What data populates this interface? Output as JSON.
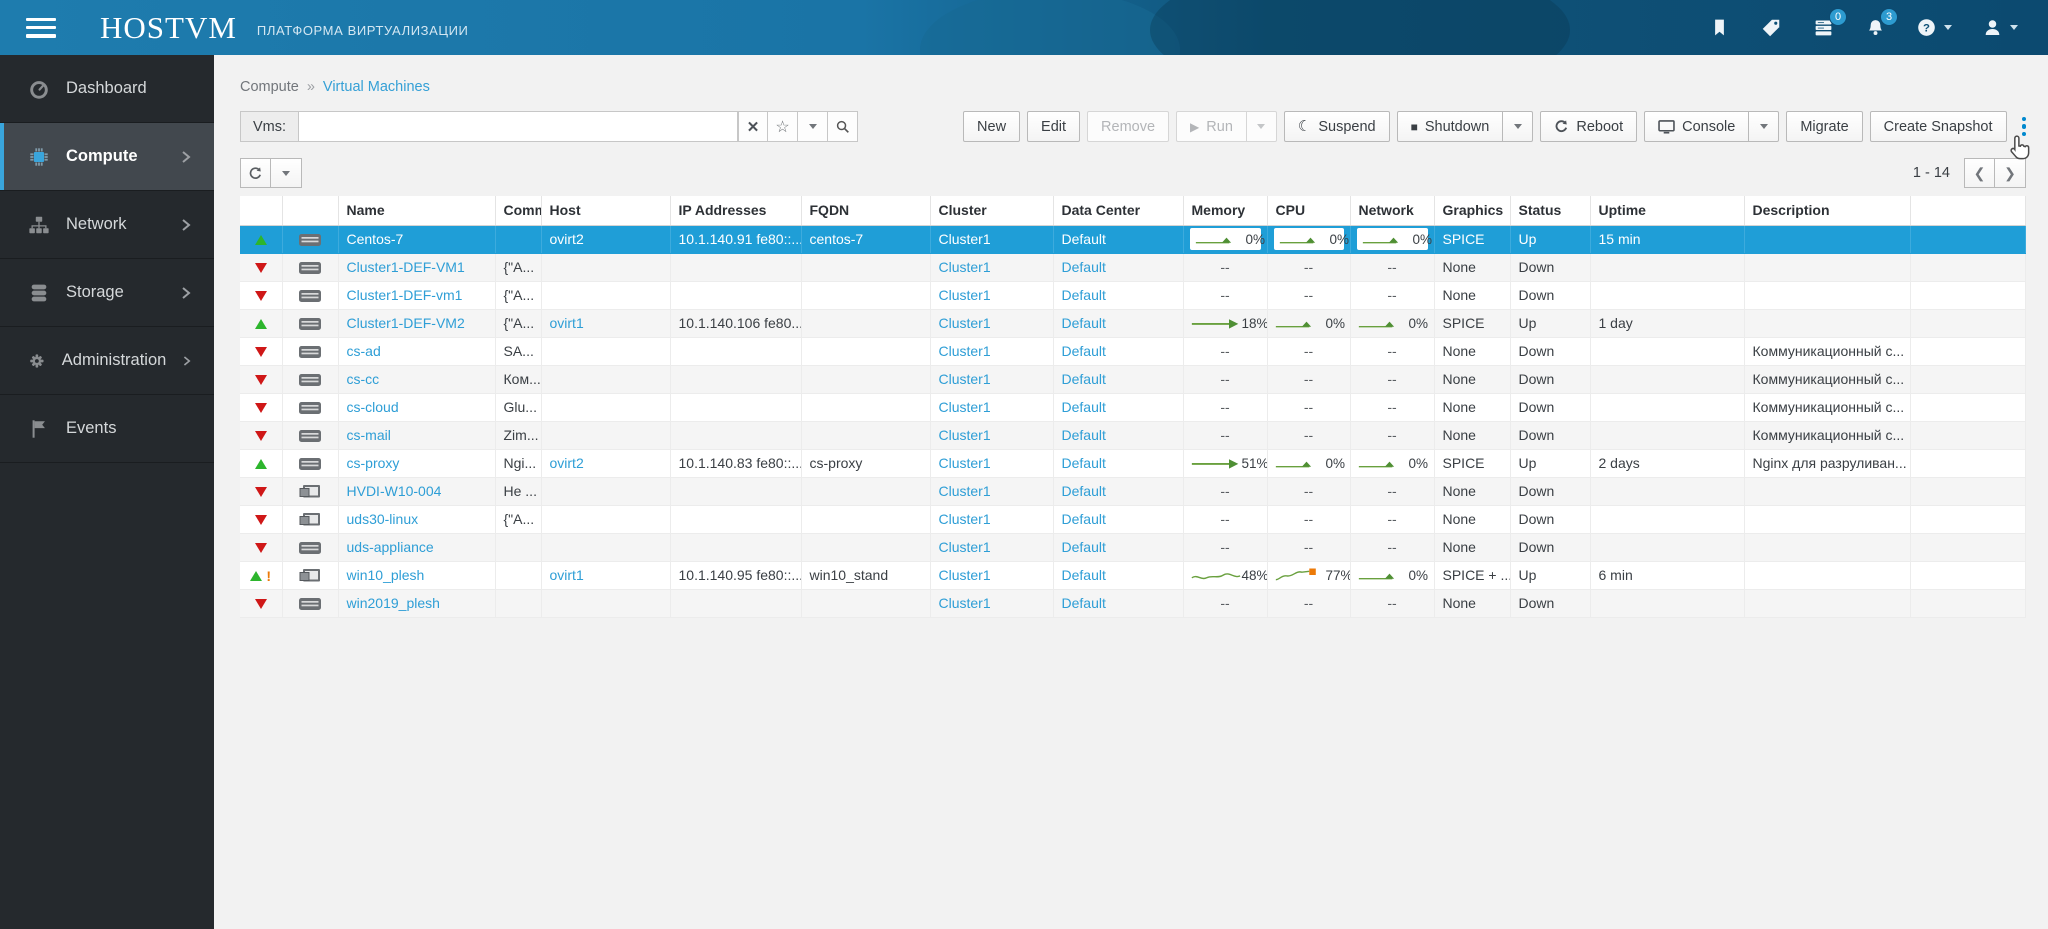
{
  "header": {
    "brand": "HOSTVM",
    "subtitle": "ПЛАТФОРМА ВИРТУАЛИЗАЦИИ",
    "actions": [
      {
        "icon": "bookmark-icon"
      },
      {
        "icon": "tag-icon"
      },
      {
        "icon": "tasks-icon",
        "badge": "0"
      },
      {
        "icon": "bell-icon",
        "badge": "3"
      },
      {
        "icon": "help-icon",
        "caret": true
      },
      {
        "icon": "user-icon",
        "caret": true
      }
    ]
  },
  "sidebar": {
    "items": [
      {
        "label": "Dashboard",
        "icon": "gauge-icon",
        "active": false,
        "chevron": false
      },
      {
        "label": "Compute",
        "icon": "cpu-icon",
        "active": true,
        "chevron": true
      },
      {
        "label": "Network",
        "icon": "network-icon",
        "active": false,
        "chevron": true
      },
      {
        "label": "Storage",
        "icon": "storage-icon",
        "active": false,
        "chevron": true
      },
      {
        "label": "Administration",
        "icon": "gear-icon",
        "active": false,
        "chevron": true
      },
      {
        "label": "Events",
        "icon": "flag-icon",
        "active": false,
        "chevron": false
      }
    ]
  },
  "breadcrumb": {
    "section": "Compute",
    "separator": "»",
    "page": "Virtual Machines"
  },
  "search": {
    "label": "Vms:",
    "value": "",
    "icons": [
      "clear-icon",
      "star-icon",
      "caret-icon",
      "search-icon"
    ]
  },
  "toolbar": {
    "new": "New",
    "edit": "Edit",
    "remove": "Remove",
    "run": "Run",
    "suspend": "Suspend",
    "shutdown": "Shutdown",
    "reboot": "Reboot",
    "console": "Console",
    "migrate": "Migrate",
    "create_snapshot": "Create Snapshot"
  },
  "pagination": {
    "range": "1 - 14"
  },
  "table": {
    "columns": [
      "",
      "",
      "Name",
      "Comm",
      "Host",
      "IP Addresses",
      "FQDN",
      "Cluster",
      "Data Center",
      "Memory",
      "CPU",
      "Network",
      "Graphics",
      "Status",
      "Uptime",
      "Description",
      ""
    ],
    "rows": [
      {
        "status": "up",
        "warn": false,
        "type": "server",
        "selected": true,
        "name": "Centos-7",
        "comment": "",
        "host": "ovirt2",
        "ip": "10.1.140.91 fe80::...",
        "fqdn": "centos-7",
        "cluster": "Cluster1",
        "datacenter": "Default",
        "memory": {
          "val": "0%",
          "spark": "flat"
        },
        "cpu": {
          "val": "0%",
          "spark": "flat"
        },
        "network": {
          "val": "0%",
          "spark": "flat"
        },
        "graphics": "SPICE",
        "state": "Up",
        "uptime": "15 min",
        "description": ""
      },
      {
        "status": "down",
        "warn": false,
        "type": "server",
        "selected": false,
        "name": "Cluster1-DEF-VM1",
        "comment": "{\"A...",
        "host": "",
        "ip": "",
        "fqdn": "",
        "cluster": "Cluster1",
        "datacenter": "Default",
        "memory": {
          "val": "--"
        },
        "cpu": {
          "val": "--"
        },
        "network": {
          "val": "--"
        },
        "graphics": "None",
        "state": "Down",
        "uptime": "",
        "description": ""
      },
      {
        "status": "down",
        "warn": false,
        "type": "server",
        "selected": false,
        "name": "Cluster1-DEF-vm1",
        "comment": "{\"A...",
        "host": "",
        "ip": "",
        "fqdn": "",
        "cluster": "Cluster1",
        "datacenter": "Default",
        "memory": {
          "val": "--"
        },
        "cpu": {
          "val": "--"
        },
        "network": {
          "val": "--"
        },
        "graphics": "None",
        "state": "Down",
        "uptime": "",
        "description": ""
      },
      {
        "status": "up",
        "warn": false,
        "type": "server",
        "selected": false,
        "name": "Cluster1-DEF-VM2",
        "comment": "{\"A...",
        "host": "ovirt1",
        "ip": "10.1.140.106 fe80...",
        "fqdn": "",
        "cluster": "Cluster1",
        "datacenter": "Default",
        "memory": {
          "val": "18%",
          "spark": "arrow"
        },
        "cpu": {
          "val": "0%",
          "spark": "flat"
        },
        "network": {
          "val": "0%",
          "spark": "flat"
        },
        "graphics": "SPICE",
        "state": "Up",
        "uptime": "1 day",
        "description": ""
      },
      {
        "status": "down",
        "warn": false,
        "type": "server",
        "selected": false,
        "name": "cs-ad",
        "comment": "SA...",
        "host": "",
        "ip": "",
        "fqdn": "",
        "cluster": "Cluster1",
        "datacenter": "Default",
        "memory": {
          "val": "--"
        },
        "cpu": {
          "val": "--"
        },
        "network": {
          "val": "--"
        },
        "graphics": "None",
        "state": "Down",
        "uptime": "",
        "description": "Коммуникационный с..."
      },
      {
        "status": "down",
        "warn": false,
        "type": "server",
        "selected": false,
        "name": "cs-cc",
        "comment": "Ком...",
        "host": "",
        "ip": "",
        "fqdn": "",
        "cluster": "Cluster1",
        "datacenter": "Default",
        "memory": {
          "val": "--"
        },
        "cpu": {
          "val": "--"
        },
        "network": {
          "val": "--"
        },
        "graphics": "None",
        "state": "Down",
        "uptime": "",
        "description": "Коммуникационный с..."
      },
      {
        "status": "down",
        "warn": false,
        "type": "server",
        "selected": false,
        "name": "cs-cloud",
        "comment": "Glu...",
        "host": "",
        "ip": "",
        "fqdn": "",
        "cluster": "Cluster1",
        "datacenter": "Default",
        "memory": {
          "val": "--"
        },
        "cpu": {
          "val": "--"
        },
        "network": {
          "val": "--"
        },
        "graphics": "None",
        "state": "Down",
        "uptime": "",
        "description": "Коммуникационный с..."
      },
      {
        "status": "down",
        "warn": false,
        "type": "server",
        "selected": false,
        "name": "cs-mail",
        "comment": "Zim...",
        "host": "",
        "ip": "",
        "fqdn": "",
        "cluster": "Cluster1",
        "datacenter": "Default",
        "memory": {
          "val": "--"
        },
        "cpu": {
          "val": "--"
        },
        "network": {
          "val": "--"
        },
        "graphics": "None",
        "state": "Down",
        "uptime": "",
        "description": "Коммуникационный с..."
      },
      {
        "status": "up",
        "warn": false,
        "type": "server",
        "selected": false,
        "name": "cs-proxy",
        "comment": "Ngi...",
        "host": "ovirt2",
        "ip": "10.1.140.83 fe80::...",
        "fqdn": "cs-proxy",
        "cluster": "Cluster1",
        "datacenter": "Default",
        "memory": {
          "val": "51%",
          "spark": "arrow"
        },
        "cpu": {
          "val": "0%",
          "spark": "flat"
        },
        "network": {
          "val": "0%",
          "spark": "flat"
        },
        "graphics": "SPICE",
        "state": "Up",
        "uptime": "2 days",
        "description": "Nginx для разруливан..."
      },
      {
        "status": "down",
        "warn": false,
        "type": "desktop",
        "selected": false,
        "name": "HVDI-W10-004",
        "comment": "He ...",
        "host": "",
        "ip": "",
        "fqdn": "",
        "cluster": "Cluster1",
        "datacenter": "Default",
        "memory": {
          "val": "--"
        },
        "cpu": {
          "val": "--"
        },
        "network": {
          "val": "--"
        },
        "graphics": "None",
        "state": "Down",
        "uptime": "",
        "description": ""
      },
      {
        "status": "down",
        "warn": false,
        "type": "desktop",
        "selected": false,
        "name": "uds30-linux",
        "comment": "{\"A...",
        "host": "",
        "ip": "",
        "fqdn": "",
        "cluster": "Cluster1",
        "datacenter": "Default",
        "memory": {
          "val": "--"
        },
        "cpu": {
          "val": "--"
        },
        "network": {
          "val": "--"
        },
        "graphics": "None",
        "state": "Down",
        "uptime": "",
        "description": ""
      },
      {
        "status": "down",
        "warn": false,
        "type": "server",
        "selected": false,
        "name": "uds-appliance",
        "comment": "",
        "host": "",
        "ip": "",
        "fqdn": "",
        "cluster": "Cluster1",
        "datacenter": "Default",
        "memory": {
          "val": "--"
        },
        "cpu": {
          "val": "--"
        },
        "network": {
          "val": "--"
        },
        "graphics": "None",
        "state": "Down",
        "uptime": "",
        "description": ""
      },
      {
        "status": "up",
        "warn": true,
        "type": "desktop",
        "selected": false,
        "name": "win10_plesh",
        "comment": "",
        "host": "ovirt1",
        "ip": "10.1.140.95 fe80::...",
        "fqdn": "win10_stand",
        "cluster": "Cluster1",
        "datacenter": "Default",
        "memory": {
          "val": "48%",
          "spark": "wavy"
        },
        "cpu": {
          "val": "77%",
          "spark": "wavyup"
        },
        "network": {
          "val": "0%",
          "spark": "flat"
        },
        "graphics": "SPICE + ...",
        "state": "Up",
        "uptime": "6 min",
        "description": ""
      },
      {
        "status": "down",
        "warn": false,
        "type": "server",
        "selected": false,
        "name": "win2019_plesh",
        "comment": "",
        "host": "",
        "ip": "",
        "fqdn": "",
        "cluster": "Cluster1",
        "datacenter": "Default",
        "memory": {
          "val": "--"
        },
        "cpu": {
          "val": "--"
        },
        "network": {
          "val": "--"
        },
        "graphics": "None",
        "state": "Down",
        "uptime": "",
        "description": ""
      }
    ]
  }
}
